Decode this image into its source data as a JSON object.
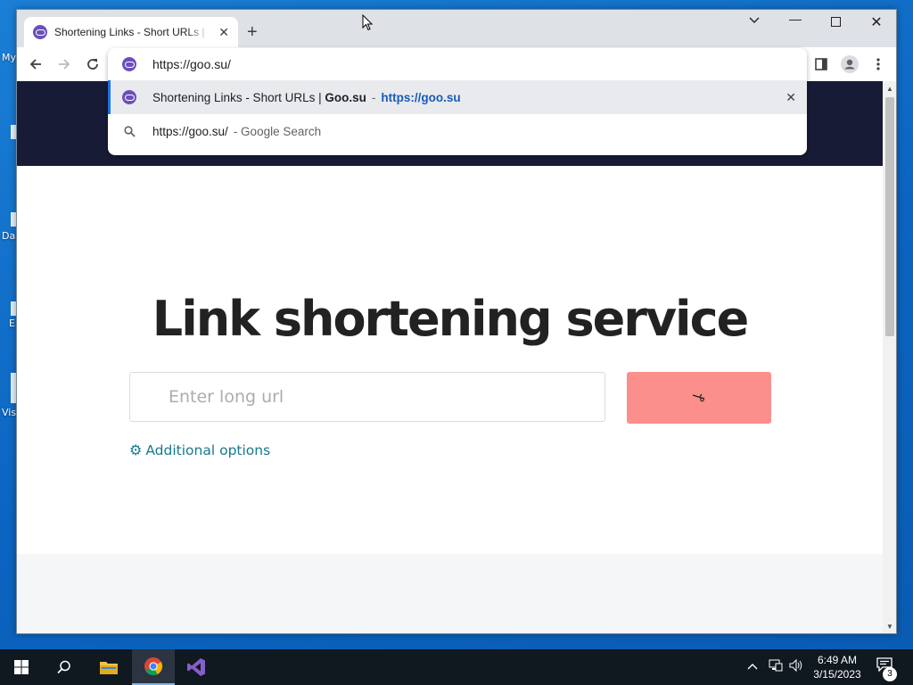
{
  "desktop": {
    "labels": [
      "My",
      "Da",
      "E",
      "Vis"
    ]
  },
  "browser": {
    "tab_title": "Shortening Links - Short URLs | Goo.su",
    "new_tab_label": "+",
    "address_value": "https://goo.su/",
    "suggestions": [
      {
        "title": "Shortening Links - Short URLs | ",
        "title_bold": "Goo.su",
        "separator": "-",
        "url": "https://goo.su"
      },
      {
        "query": "https://goo.su/",
        "suffix": "- Google Search"
      }
    ]
  },
  "page": {
    "title": "Link shortening service",
    "input_placeholder": "Enter long url",
    "additional_options_label": "Additional options",
    "header_color": "#171b35",
    "button_color": "#fb8f8c",
    "link_color": "#19798f"
  },
  "taskbar": {
    "time": "6:49 AM",
    "date": "3/15/2023",
    "notification_count": "3"
  }
}
